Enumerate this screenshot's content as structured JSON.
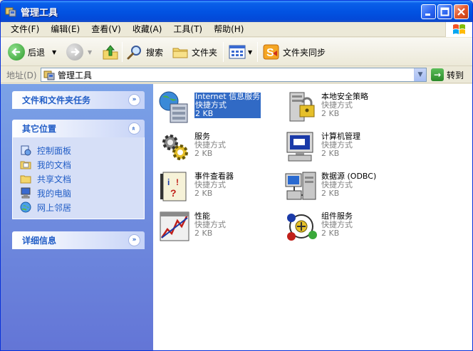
{
  "window": {
    "title": "管理工具",
    "controls": [
      "minimize",
      "maximize",
      "close"
    ]
  },
  "menu": {
    "items": [
      "文件(F)",
      "编辑(E)",
      "查看(V)",
      "收藏(A)",
      "工具(T)",
      "帮助(H)"
    ]
  },
  "toolbar": {
    "back_label": "后退",
    "search_label": "搜索",
    "folders_label": "文件夹",
    "sync_label": "文件夹同步"
  },
  "address": {
    "label": "地址(D)",
    "value": "管理工具",
    "go_label": "转到"
  },
  "left_pane": {
    "file_tasks": {
      "title": "文件和文件夹任务"
    },
    "other_places": {
      "title": "其它位置",
      "links": [
        "控制面板",
        "我的文档",
        "共享文档",
        "我的电脑",
        "网上邻居"
      ]
    },
    "details": {
      "title": "详细信息"
    }
  },
  "files": [
    {
      "name": "Internet 信息服务",
      "type": "快捷方式",
      "size": "2 KB",
      "icon": "iis-icon",
      "selected": true
    },
    {
      "name": "本地安全策略",
      "type": "快捷方式",
      "size": "2 KB",
      "icon": "local-security-policy-icon",
      "selected": false
    },
    {
      "name": "服务",
      "type": "快捷方式",
      "size": "2 KB",
      "icon": "services-icon",
      "selected": false
    },
    {
      "name": "计算机管理",
      "type": "快捷方式",
      "size": "2 KB",
      "icon": "computer-management-icon",
      "selected": false
    },
    {
      "name": "事件查看器",
      "type": "快捷方式",
      "size": "2 KB",
      "icon": "event-viewer-icon",
      "selected": false
    },
    {
      "name": "数据源 (ODBC)",
      "type": "快捷方式",
      "size": "2 KB",
      "icon": "odbc-data-source-icon",
      "selected": false
    },
    {
      "name": "性能",
      "type": "快捷方式",
      "size": "2 KB",
      "icon": "performance-icon",
      "selected": false
    },
    {
      "name": "组件服务",
      "type": "快捷方式",
      "size": "2 KB",
      "icon": "component-services-icon",
      "selected": false
    }
  ],
  "colors": {
    "titlebar": "#0253e2",
    "task_pane": "#7ba2e7",
    "link": "#215dc6",
    "selection": "#316ac5"
  }
}
